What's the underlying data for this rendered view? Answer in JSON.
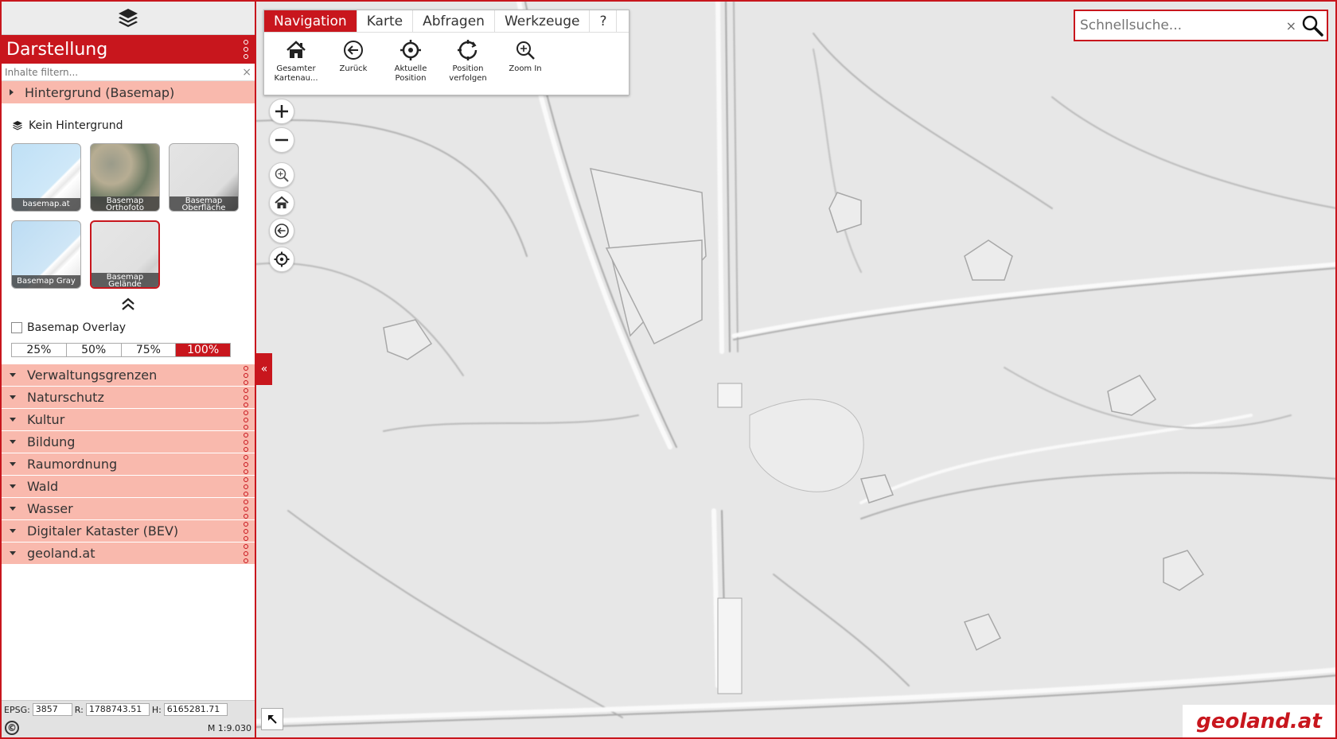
{
  "sidebar": {
    "panel_title": "Darstellung",
    "filter_placeholder": "Inhalte filtern...",
    "filter_clear": "×",
    "basemap_group": "Hintergrund (Basemap)",
    "no_background": "Kein Hintergrund",
    "tiles": [
      {
        "label": "basemap.at"
      },
      {
        "label": "Basemap Orthofoto"
      },
      {
        "label": "Basemap Oberfläche"
      },
      {
        "label": "Basemap Gray"
      },
      {
        "label": "Basemap Gelände",
        "selected": true
      }
    ],
    "overlay_label": "Basemap Overlay",
    "opacity_options": [
      "25%",
      "50%",
      "75%",
      "100%"
    ],
    "opacity_active": "100%",
    "groups": [
      "Verwaltungsgrenzen",
      "Naturschutz",
      "Kultur",
      "Bildung",
      "Raumordnung",
      "Wald",
      "Wasser",
      "Digitaler Kataster (BEV)",
      "geoland.at"
    ]
  },
  "footer": {
    "epsg_label": "EPSG:",
    "epsg_value": "3857",
    "r_label": "R:",
    "r_value": "1788743.51",
    "h_label": "H:",
    "h_value": "6165281.71",
    "copyright": "©",
    "scale": "M 1:9.030"
  },
  "ribbon": {
    "tabs": [
      "Navigation",
      "Karte",
      "Abfragen",
      "Werkzeuge",
      "?"
    ],
    "active_tab": "Navigation",
    "tools": [
      {
        "icon": "home-icon",
        "label": "Gesamter Kartenau..."
      },
      {
        "icon": "back-icon",
        "label": "Zurück"
      },
      {
        "icon": "crosshair-icon",
        "label": "Aktuelle Position"
      },
      {
        "icon": "track-position-icon",
        "label": "Position verfolgen"
      },
      {
        "icon": "zoom-in-icon",
        "label": "Zoom In"
      }
    ]
  },
  "search": {
    "placeholder": "Schnellsuche...",
    "clear": "×"
  },
  "collapse_label": "«",
  "logo": "geoland.at",
  "colors": {
    "accent": "#c8161d",
    "group_bg": "#f9b9ad"
  }
}
